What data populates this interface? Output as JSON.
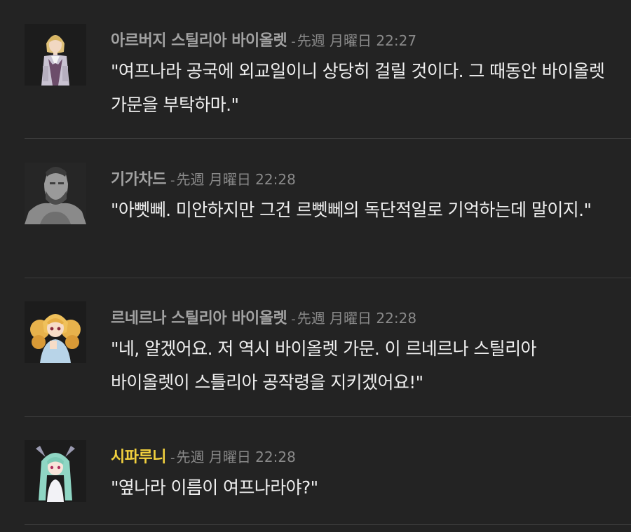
{
  "messages": [
    {
      "name": "아르버지 스틸리아 바이올렛",
      "time": "先週 月曜日 22:27",
      "text": "\"여프나라 공국에 외교일이니 상당히 걸릴 것이다. 그 때동안 바이올렛 가문을 부탁하마.\"",
      "avatar": "character-avatar-blonde-noble-icon"
    },
    {
      "name": "기가차드",
      "time": "先週 月曜日 22:28",
      "text": "\"아뻿뻬. 미안하지만 그건 르뻿뻬의 독단적일로 기억하는데 말이지.\"",
      "avatar": "character-avatar-gigachad-icon"
    },
    {
      "name": "르네르나 스틸리아 바이올렛",
      "time": "先週 月曜日 22:28",
      "text": "\"네, 알겠어요. 저 역시 바이올렛 가문. 이 르네르나 스틸리아 바이올렛이 스틀리아 공작령을 지키겠어요!\"",
      "avatar": "character-avatar-blonde-twintail-icon"
    },
    {
      "name": "시파루니",
      "time": "先週 月曜日 22:28",
      "text": "\"옆나라 이름이 여프나라야?\"",
      "avatar": "character-avatar-green-hair-icon"
    }
  ],
  "colors": {
    "background": "#232323",
    "name_default": "#a2a2a2",
    "name_highlight": "#f2d13e",
    "timestamp": "#8a8a8a",
    "message_text": "#efefef"
  }
}
